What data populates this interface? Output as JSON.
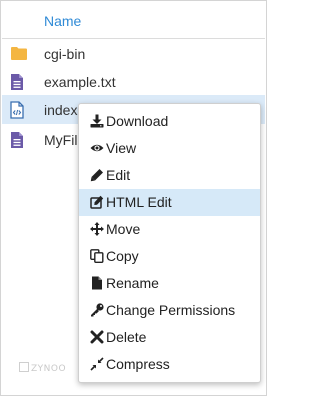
{
  "file_list": {
    "column_header": "Name",
    "rows": [
      {
        "name": "cgi-bin",
        "icon": "folder-icon"
      },
      {
        "name": "example.txt",
        "icon": "text-file-icon"
      },
      {
        "name": "index.",
        "icon": "html-file-icon",
        "selected": true
      },
      {
        "name": "MyFile",
        "icon": "text-file-icon"
      }
    ]
  },
  "context_menu": {
    "items": [
      {
        "label": "Download",
        "icon": "download-icon"
      },
      {
        "label": "View",
        "icon": "eye-icon"
      },
      {
        "label": "Edit",
        "icon": "pencil-icon"
      },
      {
        "label": "HTML Edit",
        "icon": "edit-square-icon",
        "highlighted": true
      },
      {
        "label": "Move",
        "icon": "move-arrows-icon"
      },
      {
        "label": "Copy",
        "icon": "copy-icon"
      },
      {
        "label": "Rename",
        "icon": "file-icon"
      },
      {
        "label": "Change Permissions",
        "icon": "key-icon"
      },
      {
        "label": "Delete",
        "icon": "x-icon"
      },
      {
        "label": "Compress",
        "icon": "compress-icon"
      }
    ]
  },
  "watermark": "ZYNOO",
  "colors": {
    "accent": "#2f8ad6",
    "file_icon": "#6b5aa8",
    "folder_icon": "#f4b642",
    "selection": "#dbeaf8",
    "menu_hover": "#d6e9f8"
  }
}
